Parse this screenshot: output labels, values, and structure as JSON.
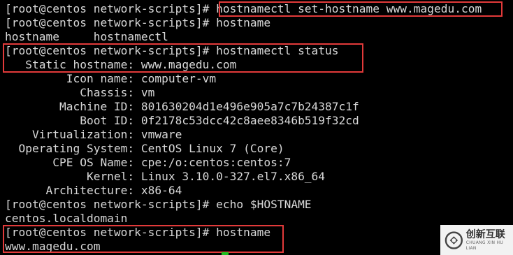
{
  "terminal": {
    "lines": [
      "[root@centos network-scripts]# hostnamectl set-hostname www.magedu.com",
      "[root@centos network-scripts]# hostname",
      "hostname     hostnamectl",
      "[root@centos network-scripts]# hostnamectl status",
      "   Static hostname: www.magedu.com",
      "         Icon name: computer-vm",
      "           Chassis: vm",
      "        Machine ID: 801630204d1e496e905a7c7b24387c1f",
      "           Boot ID: 0f2178c53dcc42c8aee8346b519f32cd",
      "    Virtualization: vmware",
      "  Operating System: CentOS Linux 7 (Core)",
      "       CPE OS Name: cpe:/o:centos:centos:7",
      "            Kernel: Linux 3.10.0-327.el7.x86_64",
      "      Architecture: x86-64",
      "[root@centos network-scripts]# echo $HOSTNAME",
      "centos.localdomain",
      "[root@centos network-scripts]# hostname",
      "www.magedu.com"
    ],
    "highlight_color": "#e23a3a",
    "text_color": "#d8d8d8",
    "background_color": "#000000",
    "cursor_color": "#20c020"
  },
  "watermark": {
    "name": "创新互联",
    "subtitle": "CHUANG XIN HU LIAN"
  }
}
